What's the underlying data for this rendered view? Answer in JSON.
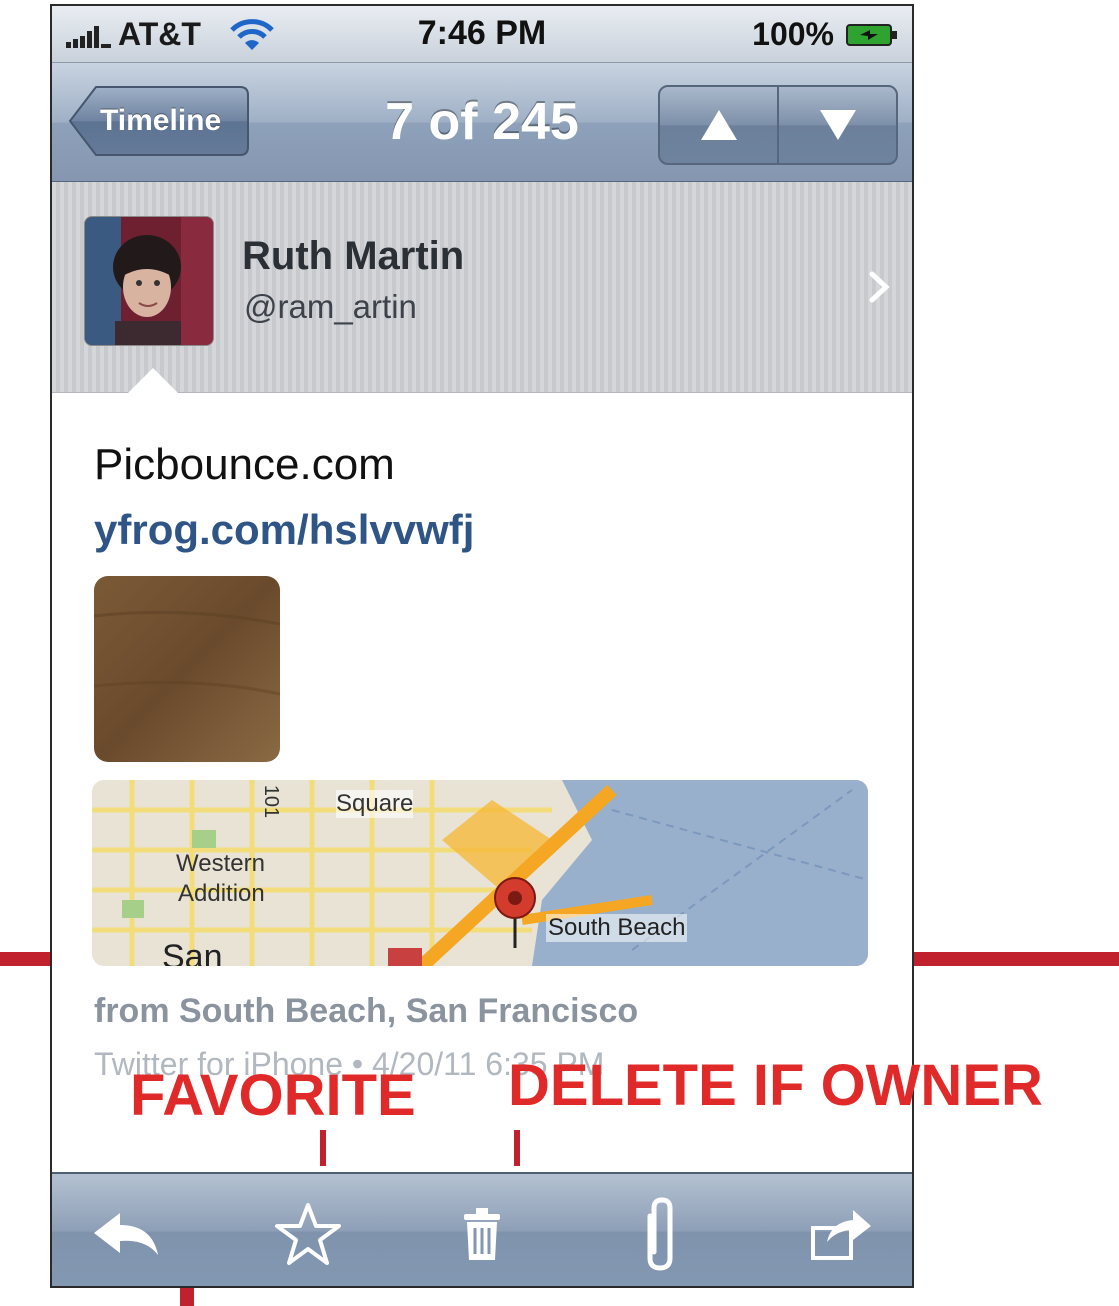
{
  "status_bar": {
    "carrier": "AT&T",
    "time": "7:46 PM",
    "battery": "100%"
  },
  "nav": {
    "back_label": "Timeline",
    "title": "7 of 245",
    "up_icon": "triangle-up-icon",
    "down_icon": "triangle-down-icon"
  },
  "profile": {
    "name": "Ruth Martin",
    "handle": "@ram_artin"
  },
  "tweet": {
    "text": "Picbounce.com",
    "link": "yfrog.com/hslvvwfj",
    "location": "from South Beach, San Francisco",
    "source": "Twitter for iPhone • 4/20/11 6:35 PM"
  },
  "map": {
    "labels": {
      "square": "Square",
      "western": "Western",
      "addition": "Addition",
      "south_beach": "South Beach",
      "san": "San",
      "highway": "101"
    }
  },
  "toolbar": {
    "items": [
      "reply-icon",
      "star-icon",
      "trash-icon",
      "paperclip-icon",
      "share-icon"
    ]
  },
  "annotations": {
    "favorite": "FAVORITE",
    "delete": "DELETE IF OWNER"
  },
  "colors": {
    "annotation_red": "#e02a2a",
    "link_blue": "#2f5587",
    "nav_blue": "#8ea1ba"
  }
}
